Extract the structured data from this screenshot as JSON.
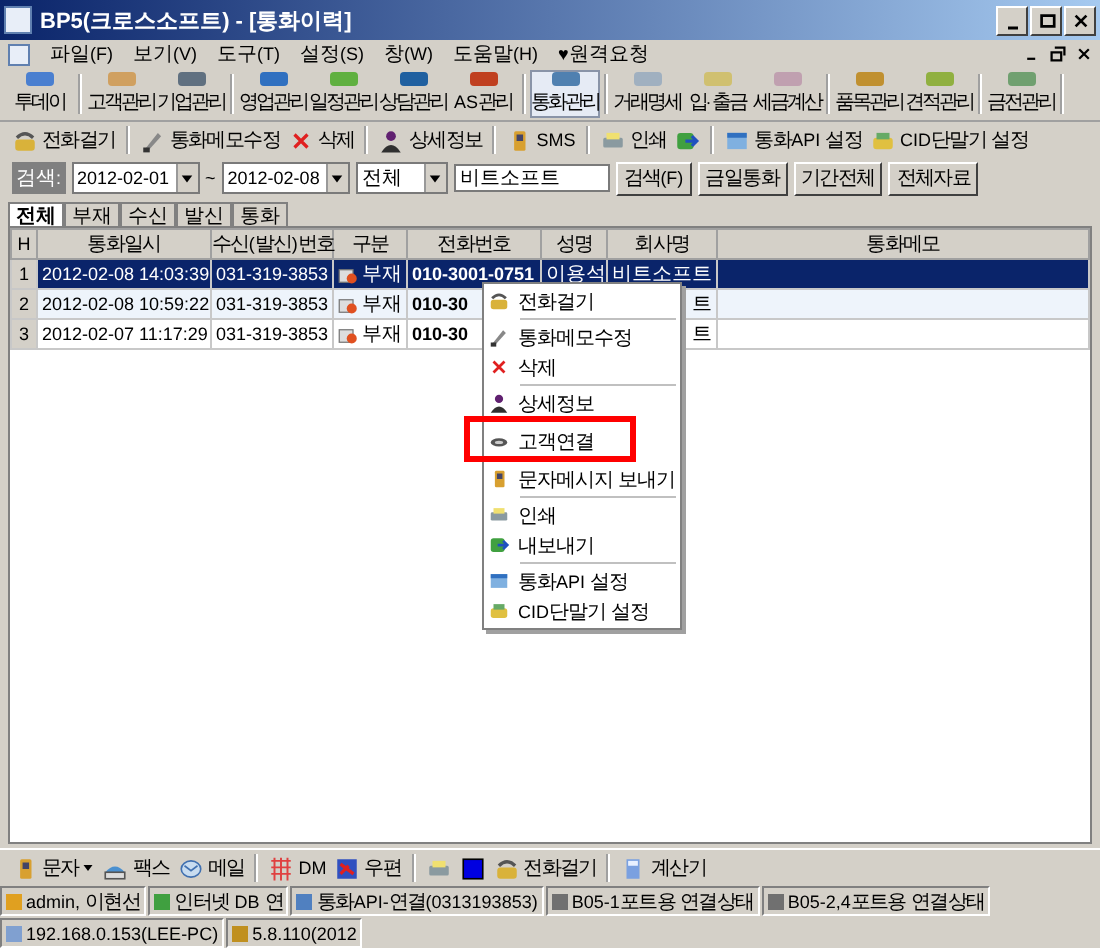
{
  "window": {
    "title": "BP5(크로스소프트) - [통화이력]"
  },
  "menu_bar": [
    "파일(F)",
    "보기(V)",
    "도구(T)",
    "설정(S)",
    "창(W)",
    "도움말(H)",
    "♥원격요청"
  ],
  "main_toolbar": [
    {
      "label": "투데이",
      "selected": false,
      "group_end": true
    },
    {
      "label": "고객관리",
      "selected": false
    },
    {
      "label": "기업관리",
      "selected": false,
      "group_end": true
    },
    {
      "label": "영업관리",
      "selected": false
    },
    {
      "label": "일정관리",
      "selected": false
    },
    {
      "label": "상담관리",
      "selected": false
    },
    {
      "label": "AS관리",
      "selected": false,
      "group_end": true
    },
    {
      "label": "통화관리",
      "selected": true,
      "group_end": true
    },
    {
      "label": "거래명세",
      "selected": false
    },
    {
      "label": "입·출금",
      "selected": false
    },
    {
      "label": "세금계산",
      "selected": false,
      "group_end": true
    },
    {
      "label": "품목관리",
      "selected": false
    },
    {
      "label": "견적관리",
      "selected": false,
      "group_end": true
    },
    {
      "label": "금전관리",
      "selected": false,
      "group_end": true
    }
  ],
  "action_toolbar": [
    {
      "label": "전화걸기",
      "kind": "phone",
      "group_end": true
    },
    {
      "label": "통화메모수정",
      "kind": "memo"
    },
    {
      "label": "삭제",
      "kind": "delete",
      "group_end": true
    },
    {
      "label": "상세정보",
      "kind": "person",
      "group_end": true
    },
    {
      "label": "SMS",
      "kind": "mobile",
      "group_end": true
    },
    {
      "label": "인쇄",
      "kind": "print"
    },
    {
      "kind": "export",
      "group_end": true
    },
    {
      "label": "통화API 설정",
      "kind": "window"
    },
    {
      "label": "CID단말기 설정",
      "kind": "device"
    }
  ],
  "search": {
    "label": "검색:",
    "date_from": "2012-02-01",
    "separator": "~",
    "date_to": "2012-02-08",
    "type": "전체",
    "keyword": "비트소프트",
    "buttons": [
      "검색(F)",
      "금일통화",
      "기간전체",
      "전체자료"
    ]
  },
  "tabs": [
    {
      "label": "전체",
      "selected": true
    },
    {
      "label": "부재",
      "selected": false
    },
    {
      "label": "수신",
      "selected": false
    },
    {
      "label": "발신",
      "selected": false
    },
    {
      "label": "통화",
      "selected": false
    }
  ],
  "table": {
    "columns": [
      "H",
      "통화일시",
      "수신(발신)번호",
      "구분",
      "전화번호",
      "성명",
      "회사명",
      "통화메모"
    ],
    "rows": [
      {
        "cells": [
          "1",
          "2012-02-08 14:03:39",
          "031-319-3853",
          "부재",
          "010-3001-0751",
          "이용석",
          "비트소프트",
          ""
        ],
        "selected": true
      },
      {
        "cells": [
          "2",
          "2012-02-08 10:59:22",
          "031-319-3853",
          "부재",
          "010-30",
          "",
          "트",
          ""
        ],
        "selected": false
      },
      {
        "cells": [
          "3",
          "2012-02-07 11:17:29",
          "031-319-3853",
          "부재",
          "010-30",
          "",
          "트",
          ""
        ],
        "selected": false
      }
    ]
  },
  "context_menu": [
    {
      "label": "전화걸기",
      "kind": "phone",
      "separator_after": true
    },
    {
      "label": "통화메모수정",
      "kind": "memo"
    },
    {
      "label": "삭제",
      "kind": "delete",
      "separator_after": true
    },
    {
      "label": "상세정보",
      "kind": "person"
    },
    {
      "label": "고객연결",
      "kind": "link",
      "highlighted": true
    },
    {
      "label": "문자메시지 보내기",
      "kind": "mobile",
      "separator_after": true
    },
    {
      "label": "인쇄",
      "kind": "print"
    },
    {
      "label": "내보내기",
      "kind": "export",
      "separator_after": true
    },
    {
      "label": "통화API 설정",
      "kind": "window"
    },
    {
      "label": "CID단말기 설정",
      "kind": "device"
    }
  ],
  "bottom_toolbar": [
    {
      "label": "문자",
      "kind": "mobile",
      "dropdown": true
    },
    {
      "label": "팩스",
      "kind": "fax"
    },
    {
      "label": "메일",
      "kind": "mail",
      "group_end": true
    },
    {
      "label": "DM",
      "kind": "dm"
    },
    {
      "label": "우편",
      "kind": "post",
      "group_end": true
    },
    {
      "kind": "print"
    },
    {
      "kind": "blue"
    },
    {
      "label": "전화걸기",
      "kind": "phone",
      "group_end": true
    },
    {
      "label": "계산기",
      "kind": "calc"
    }
  ],
  "status_bar": [
    "admin, 이현선",
    "인터넷 DB 연",
    "통화API-연결(0313193853)",
    "B05-1포트용 연결상태",
    "B05-2,4포트용 연결상태",
    "192.168.0.153(LEE-PC)",
    "5.8.110(2012"
  ]
}
